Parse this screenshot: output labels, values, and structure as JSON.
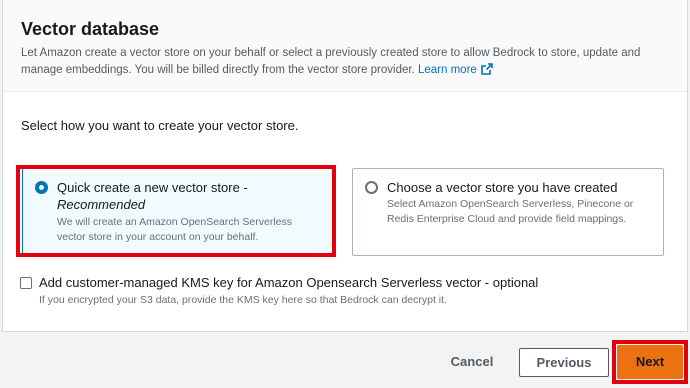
{
  "card": {
    "title": "Vector database",
    "description": "Let Amazon create a vector store on your behalf or select a previously created store to allow Bedrock to store, update and manage embeddings. You will be billed directly from the vector store provider.",
    "learn_more": "Learn more"
  },
  "section_label": "Select how you want to create your vector store.",
  "options": [
    {
      "title": "Quick create a new vector store -",
      "subtitle": "Recommended",
      "description": "We will create an Amazon OpenSearch Serverless vector store in your account on your behalf.",
      "selected": true
    },
    {
      "title": "Choose a vector store you have created",
      "description": "Select Amazon OpenSearch Serverless, Pinecone or Redis Enterprise Cloud and provide field mappings.",
      "selected": false
    }
  ],
  "kms": {
    "label": "Add customer-managed KMS key for Amazon Opensearch Serverless vector - optional",
    "description": "If you encrypted your S3 data, provide the KMS key here so that Bedrock can decrypt it.",
    "checked": false
  },
  "footer": {
    "cancel": "Cancel",
    "previous": "Previous",
    "next": "Next"
  },
  "colors": {
    "accent": "#0073bb",
    "primary_button": "#ec7211",
    "highlight": "#e3000f"
  }
}
